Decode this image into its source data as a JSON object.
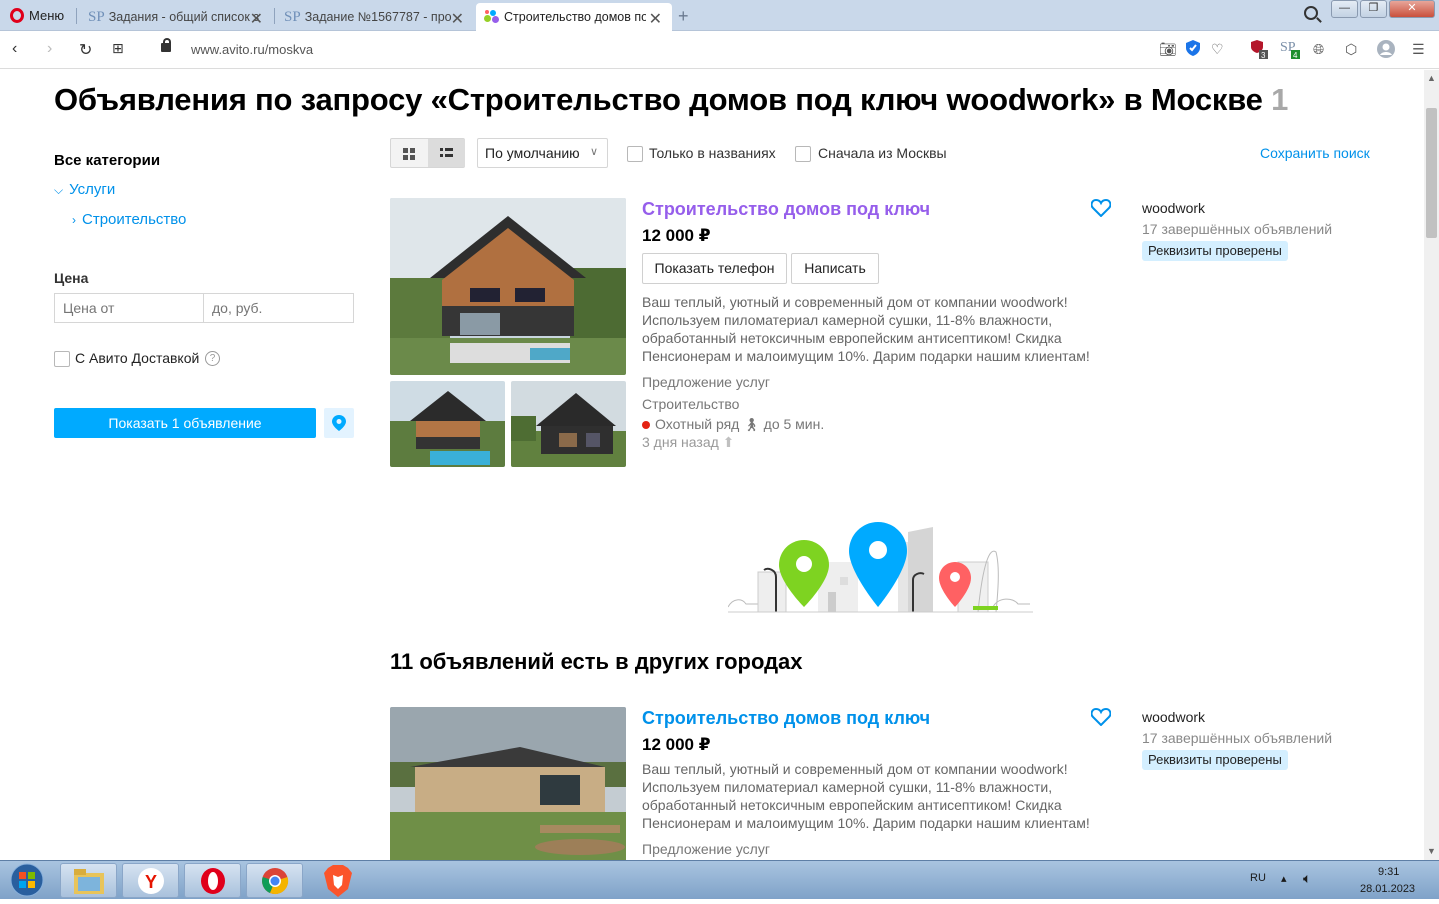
{
  "browser": {
    "menu_label": "Меню",
    "tabs": [
      {
        "title": "Задания - общий список з"
      },
      {
        "title": "Задание №1567787 - про"
      },
      {
        "title": "Строительство домов под"
      }
    ],
    "url": "www.avito.ru/moskva",
    "ext_badges": {
      "shield": "3",
      "sp": "4"
    }
  },
  "page": {
    "title": "Объявления по запросу «Строительство домов под ключ woodwork» в Москве",
    "result_count": "1"
  },
  "sidebar": {
    "all_categories": "Все категории",
    "categories": [
      {
        "label": "Услуги"
      },
      {
        "label": "Строительство"
      }
    ],
    "price_label": "Цена",
    "price_from_placeholder": "Цена от",
    "price_to_placeholder": "до, руб.",
    "delivery_label": "С Авито Доставкой",
    "show_button": "Показать 1 объявление"
  },
  "toolbar": {
    "sort_selected": "По умолчанию",
    "only_titles": "Только в названиях",
    "moscow_first": "Сначала из Москвы",
    "save_search": "Сохранить поиск"
  },
  "listings": [
    {
      "title": "Строительство домов под ключ",
      "title_color": "#965eeb",
      "price": "12 000 ₽",
      "show_phone": "Показать телефон",
      "write": "Написать",
      "description": "Ваш теплый, уютный и современный дом от компании woodwork! Используем пиломатериал камерной сушки, 11-8% влажности, обработанный нетоксичным европейским антисептиком! Скидка Пенсионерам и малоимущим 10%. Дарим подарки нашим клиентам!",
      "type": "Предложение услуг",
      "category": "Строительство",
      "metro": "Охотный ряд",
      "walk": "до 5 мин.",
      "age": "3 дня назад",
      "seller": "woodwork",
      "seller_completed": "17 завершённых объявлений",
      "verified": "Реквизиты проверены"
    },
    {
      "title": "Строительство домов под ключ",
      "title_color": "#0091ea",
      "price": "12 000 ₽",
      "description": "Ваш теплый, уютный и современный дом от компании woodwork! Используем пиломатериал камерной сушки, 11-8% влажности, обработанный нетоксичным европейским антисептиком! Скидка Пенсионерам и малоимущим 10%. Дарим подарки нашим клиентам!",
      "type": "Предложение услуг",
      "seller": "woodwork",
      "seller_completed": "17 завершённых объявлений",
      "verified": "Реквизиты проверены"
    }
  ],
  "other_cities_heading": "11 объявлений есть в других городах",
  "taskbar": {
    "lang": "RU",
    "time": "9:31",
    "date": "28.01.2023"
  },
  "colors": {
    "accent": "#00aaff",
    "link": "#0091ea",
    "visited": "#965eeb"
  }
}
